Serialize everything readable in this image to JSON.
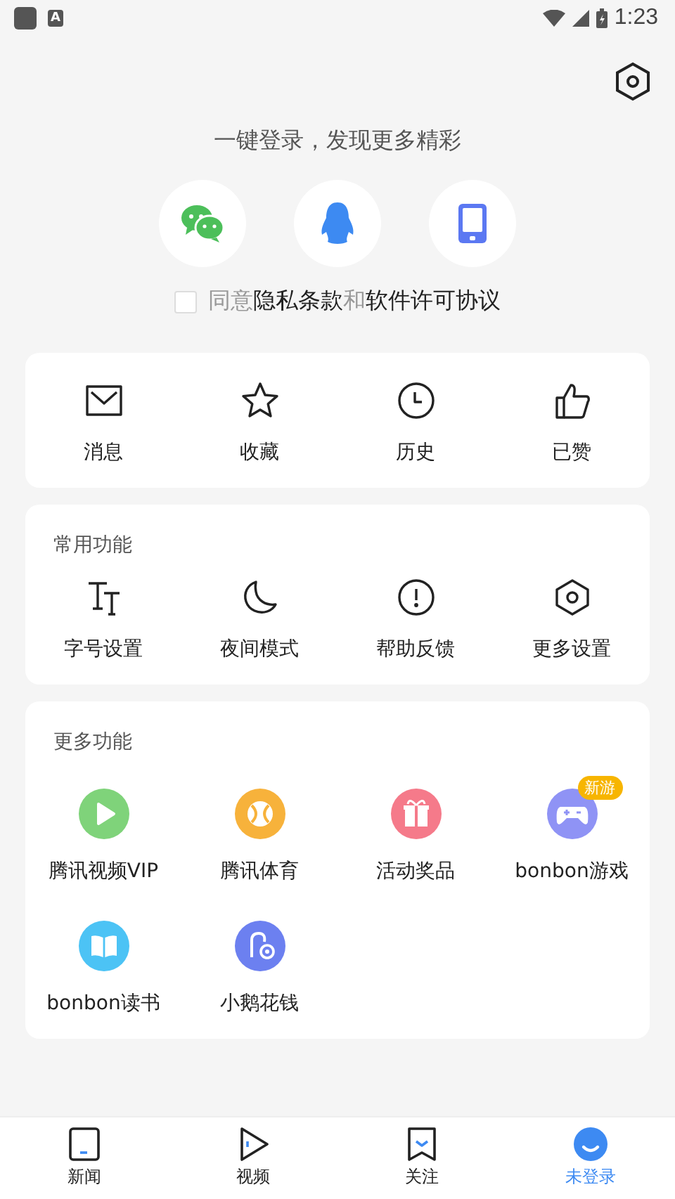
{
  "status_bar": {
    "notification_letter": "A",
    "time": "1:23"
  },
  "login": {
    "prompt": "一键登录，发现更多精彩",
    "agreement": {
      "checked": false,
      "parts": [
        {
          "text": "同意",
          "link": false
        },
        {
          "text": "隐私条款",
          "link": true
        },
        {
          "text": "和",
          "link": false
        },
        {
          "text": "软件许可协议",
          "link": true
        }
      ]
    }
  },
  "quick_actions": [
    {
      "label": "消息"
    },
    {
      "label": "收藏"
    },
    {
      "label": "历史"
    },
    {
      "label": "已赞"
    }
  ],
  "common_functions": {
    "title": "常用功能",
    "items": [
      {
        "label": "字号设置"
      },
      {
        "label": "夜间模式"
      },
      {
        "label": "帮助反馈"
      },
      {
        "label": "更多设置"
      }
    ]
  },
  "more_functions": {
    "title": "更多功能",
    "items": [
      {
        "label": "腾讯视频VIP",
        "color": "#7fd37a"
      },
      {
        "label": "腾讯体育",
        "color": "#f7b23b"
      },
      {
        "label": "活动奖品",
        "color": "#f57a8a"
      },
      {
        "label": "bonbon游戏",
        "color": "#8f93f5",
        "badge": "新游"
      },
      {
        "label": "bonbon读书",
        "color": "#4cc3f5"
      },
      {
        "label": "小鹅花钱",
        "color": "#6c80f0"
      }
    ]
  },
  "tab_bar": [
    {
      "label": "新闻",
      "selected": false
    },
    {
      "label": "视频",
      "selected": false
    },
    {
      "label": "关注",
      "selected": false
    },
    {
      "label": "未登录",
      "selected": true
    }
  ]
}
